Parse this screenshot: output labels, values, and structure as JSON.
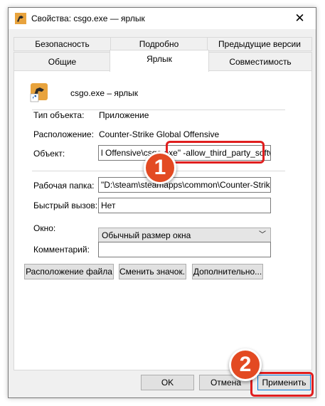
{
  "window": {
    "title": "Свойства: csgo.exe — ярлык",
    "close_glyph": "✕"
  },
  "tabs": {
    "row1": [
      "Безопасность",
      "Подробно",
      "Предыдущие версии"
    ],
    "row2": [
      "Общие",
      "Ярлык",
      "Совместимость"
    ],
    "active": "Ярлык"
  },
  "shortcut": {
    "name": "csgo.exe – ярлык"
  },
  "properties": {
    "type_label": "Тип объекта:",
    "type_value": "Приложение",
    "location_label": "Расположение:",
    "location_value": "Counter-Strike Global Offensive",
    "target_label": "Объект:",
    "target_value": "l Offensive\\csgo.exe\" -allow_third_party_software",
    "workdir_label": "Рабочая папка:",
    "workdir_value": "\"D:\\steam\\steamapps\\common\\Counter-Strike Glo",
    "hotkey_label": "Быстрый вызов:",
    "hotkey_value": "Нет",
    "window_label": "Окно:",
    "window_value": "Обычный размер окна",
    "comment_label": "Комментарий:",
    "comment_value": ""
  },
  "buttons": {
    "file_location": "Расположение файла",
    "change_icon": "Сменить значок...",
    "advanced": "Дополнительно...",
    "ok": "OK",
    "cancel": "Отмена",
    "apply": "Применить"
  },
  "annotations": {
    "badge1": "1",
    "badge2": "2",
    "color": "#e34a22",
    "outline_color": "#e01e1e"
  }
}
